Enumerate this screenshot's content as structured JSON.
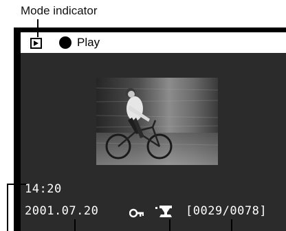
{
  "callout": {
    "mode_indicator_label": "Mode indicator"
  },
  "screen": {
    "mode_text": "Play",
    "time": "14:20",
    "date": "2001.07.20",
    "frame_counter": "[0029/0078]"
  },
  "icons": {
    "mode": "play-mode-icon",
    "record_dot": "record-dot-icon",
    "protect": "key-lock-icon",
    "print_order": "print-order-icon"
  },
  "colors": {
    "screen_frame": "#000000",
    "screen_background": "#2b2b2b",
    "mode_bar": "#ffffff",
    "osd_text": "#ffffff"
  }
}
